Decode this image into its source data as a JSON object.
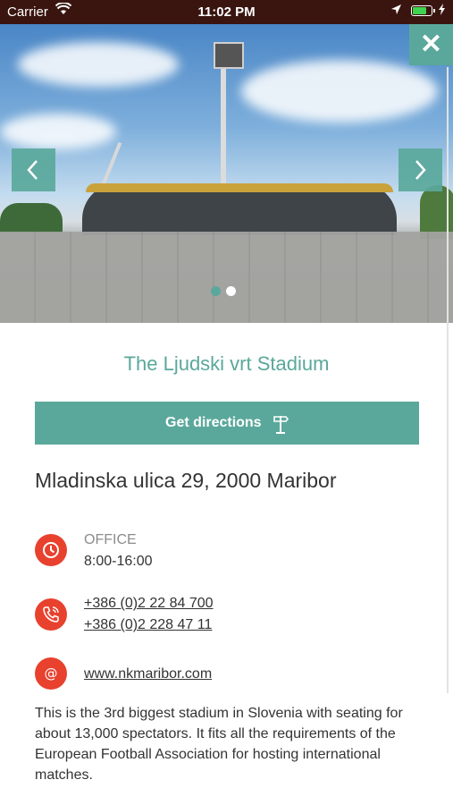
{
  "status_bar": {
    "carrier": "Carrier",
    "time": "11:02 PM",
    "battery_level": 0.8
  },
  "hero": {
    "close_label": "✕",
    "prev_label": "‹",
    "next_label": "›",
    "slide_count": 2,
    "active_slide": 0
  },
  "place": {
    "title": "The Ljudski vrt Stadium",
    "directions_label": "Get directions",
    "address": "Mladinska ulica 29, 2000 Maribor",
    "office_label": "OFFICE",
    "office_hours": "8:00-16:00",
    "phones": [
      "+386 (0)2 22 84 700",
      "+386 (0)2 228 47 11"
    ],
    "website": "www.nkmaribor.com",
    "description": "This is the 3rd biggest stadium in Slovenia with seating for about 13,000 spectators. It fits all the requirements of the European Football Association for hosting international matches."
  },
  "icons": {
    "clock": "clock-icon",
    "phone": "phone-icon",
    "web": "at-icon",
    "directions": "signpost-icon"
  },
  "colors": {
    "accent": "#5aa89b",
    "icon_bg": "#e8412e",
    "status_bar_bg": "#3a1510",
    "text": "#333333",
    "muted": "#8c8c8c"
  }
}
